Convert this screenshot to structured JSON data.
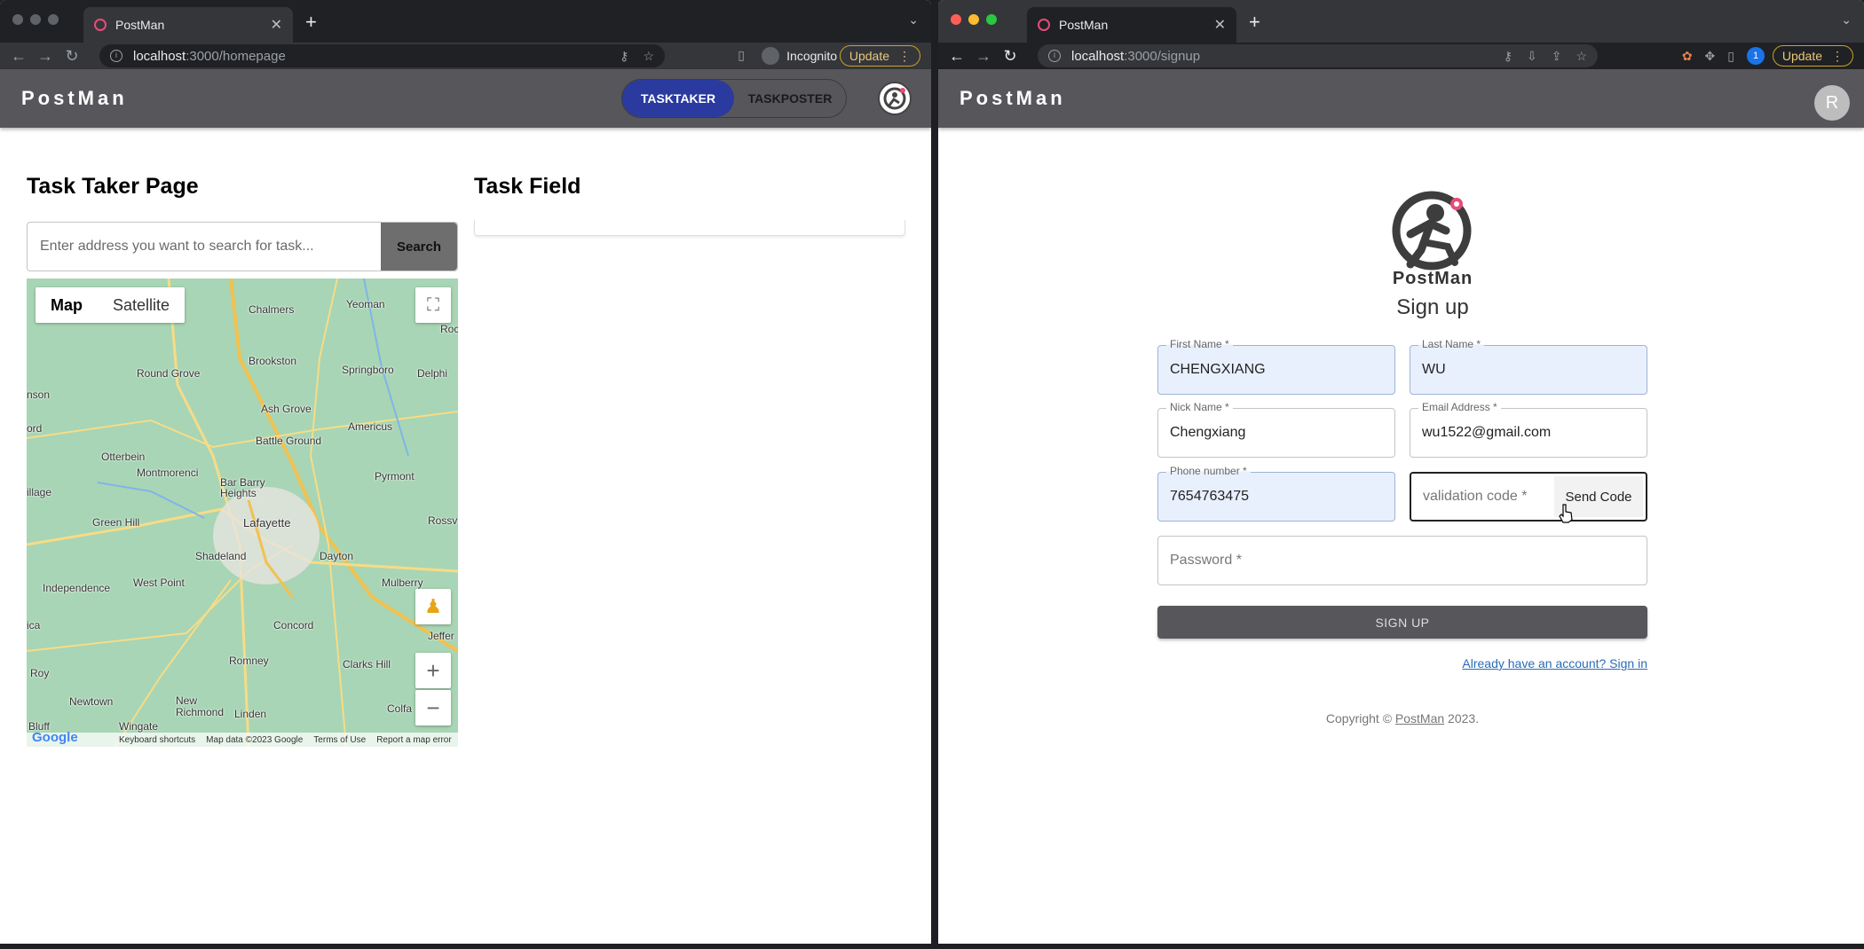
{
  "left_window": {
    "tab_title": "PostMan",
    "url_host": "localhost",
    "url_path": ":3000/homepage",
    "incognito_label": "Incognito",
    "update_label": "Update",
    "app": {
      "brand": "PostMan",
      "toggle": {
        "active": "TASKTAKER",
        "inactive": "TASKPOSTER"
      },
      "page_title": "Task Taker Page",
      "task_field_title": "Task Field",
      "search": {
        "placeholder": "Enter address you want to search for task...",
        "button": "Search"
      },
      "map": {
        "type_map": "Map",
        "type_satellite": "Satellite",
        "towns": [
          "Chalmers",
          "Yeoman",
          "Brookston",
          "Springboro",
          "Round Grove",
          "Delphi",
          "Ash Grove",
          "Americus",
          "Otterbein",
          "Battle Ground",
          "Montmorenci",
          "Bar Barry Heights",
          "Pyrmont",
          "Green Hill",
          "Lafayette",
          "Rossv",
          "Shadeland",
          "Dayton",
          "Independence",
          "West Point",
          "Mulberry",
          "Concord",
          "Jeffer",
          "Romney",
          "Clarks Hill",
          "Newtown",
          "New Richmond",
          "Colfa",
          "Wingate",
          "Linden",
          "Roy",
          "Bluff",
          "ord",
          "nson",
          "illage",
          "ica",
          "Roc"
        ],
        "footer": [
          "Keyboard shortcuts",
          "Map data ©2023 Google",
          "Terms of Use",
          "Report a map error"
        ],
        "google": "Google"
      }
    }
  },
  "right_window": {
    "tab_title": "PostMan",
    "url_host": "localhost",
    "url_path": ":3000/signup",
    "update_label": "Update",
    "ext_badge": "1",
    "app": {
      "brand": "PostMan",
      "avatar_letter": "R",
      "logo_text": "PostMan",
      "title": "Sign up",
      "fields": {
        "first_name": {
          "label": "First Name *",
          "value": "CHENGXIANG"
        },
        "last_name": {
          "label": "Last Name *",
          "value": "WU"
        },
        "nick_name": {
          "label": "Nick Name *",
          "value": "Chengxiang"
        },
        "email": {
          "label": "Email Address *",
          "value": "wu1522@gmail.com"
        },
        "phone": {
          "label": "Phone number *",
          "value": "7654763475"
        },
        "validation": {
          "placeholder": "validation code *",
          "button": "Send Code"
        },
        "password": {
          "placeholder": "Password *"
        }
      },
      "signup_button": "SIGN UP",
      "signin_link": "Already have an account? Sign in",
      "copyright_prefix": "Copyright © ",
      "copyright_link": "PostMan",
      "copyright_suffix": " 2023."
    }
  },
  "colors": {
    "appbar": "#57565b",
    "toggle_active": "#2a3a9e",
    "autofill": "#e8f0fe",
    "map_bg": "#a8d5b5"
  }
}
